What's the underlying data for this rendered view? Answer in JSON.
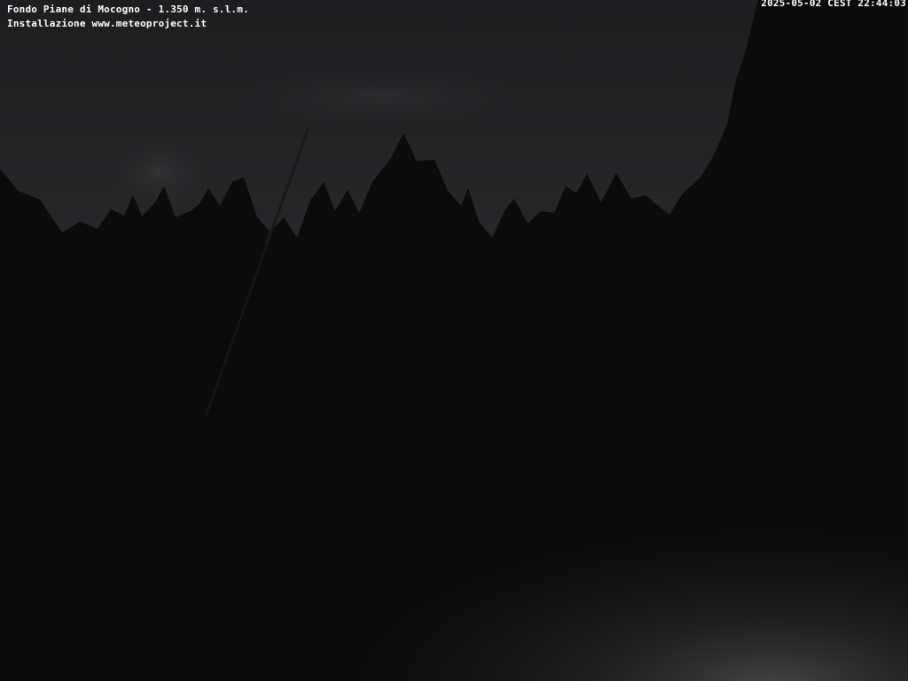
{
  "overlay": {
    "caption_line1": "Fondo Piane di Mocogno - 1.350 m. s.l.m.",
    "caption_line2": "Installazione www.meteoproject.it",
    "timestamp": "2025-05-02 CEST 22:44:03"
  },
  "scene": {
    "sky_color": "#2b2b2e",
    "treeline_color": "#0b0b0b",
    "foreground_glow_color": "#3a3d3a"
  }
}
